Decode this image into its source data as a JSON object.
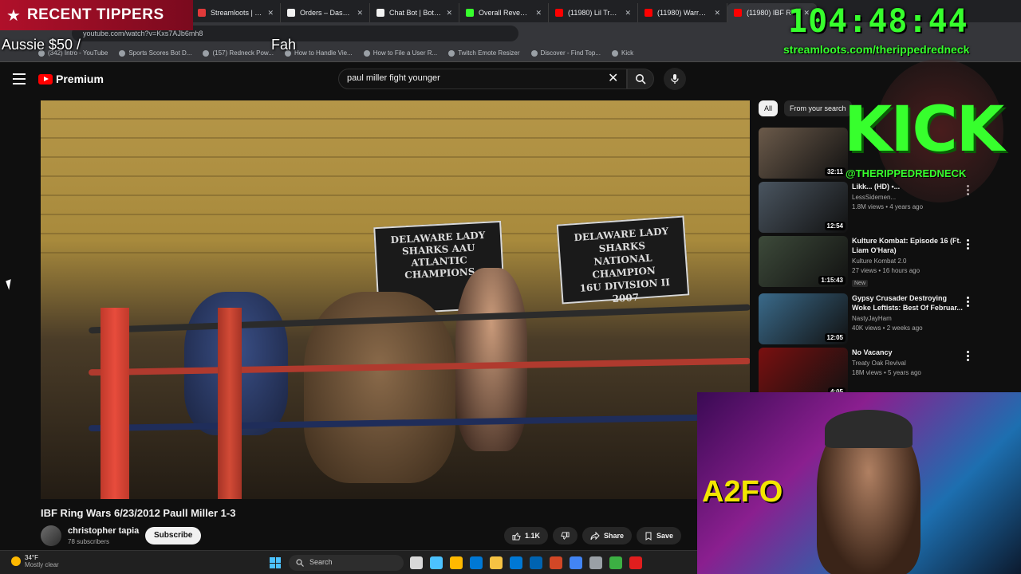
{
  "browser": {
    "tabs": [
      {
        "title": "Streamloots | The",
        "color": "#e03a3a"
      },
      {
        "title": "Orders – Dashboar",
        "color": "#f1f1f1"
      },
      {
        "title": "Chat Bot | BotRix -",
        "color": "#f1f1f1"
      },
      {
        "title": "Overall Revenue -",
        "color": "#37ff2d"
      },
      {
        "title": "(11980) Lil Troy - V",
        "color": "#ff0000"
      },
      {
        "title": "(11980) Warren G",
        "color": "#ff0000"
      },
      {
        "title": "(11980) IBF R",
        "color": "#ff0000",
        "active": true
      }
    ],
    "close_glyph": "✕",
    "url": "youtube.com/watch?v=Kxs7AJb6mh8",
    "bookmarks": [
      "(342) Intro - YouTube",
      "Sports Scores Bot D...",
      "(157) Redneck Pow...",
      "How to Handle Vie...",
      "How to File a User R...",
      "Twitch Emote Resizer",
      "Discover - Find Top...",
      "Kick"
    ]
  },
  "overlay": {
    "recent_tippers_label": "RECENT TIPPERS",
    "star_icon": "★",
    "tip_amount": "Aussie $50 /",
    "tip_name": "Fah",
    "timer": "104:48:44",
    "streamloots_url": "streamloots.com/therippedredneck",
    "kick_word": "KICK",
    "kick_handle": "@THERIPPEDREDNECK",
    "webcam_logo": "A2FO"
  },
  "youtube": {
    "logo_label": "Premium",
    "search_value": "paul miller fight younger",
    "clear_glyph": "✕",
    "video": {
      "banner1_lines": [
        "DELAWARE LADY SHARKS AAU",
        "ATLANTIC",
        "CHAMPIONS"
      ],
      "banner2_lines": [
        "DELAWARE LADY SHARKS",
        "NATIONAL CHAMPION",
        "16U DIVISION II",
        "2007"
      ],
      "title": "IBF Ring Wars 6/23/2012 Paull Miller 1-3",
      "channel": "christopher tapia",
      "subscribers": "78 subscribers",
      "subscribe_label": "Subscribe",
      "likes": "1.1K",
      "share_label": "Share",
      "save_label": "Save"
    },
    "chips": [
      "All",
      "From your search"
    ],
    "recommendations": [
      {
        "title": "",
        "channel": "",
        "meta": "",
        "duration": "32:11",
        "thumb": "#6b5a4a"
      },
      {
        "title": "Likk... (HD) •...",
        "channel": "LessSidemen...",
        "meta": "1.8M views • 4 years ago",
        "duration": "12:54",
        "thumb": "#4a5560"
      },
      {
        "title": "Kulture Kombat: Episode 16 (Ft. Liam O'Hara)",
        "channel": "Kulture Kombat 2.0",
        "meta": "27 views • 16 hours ago",
        "badge": "New",
        "duration": "1:15:43",
        "thumb": "#3d4a3a"
      },
      {
        "title": "Gypsy Crusader Destroying Woke Leftists: Best Of Februar...",
        "channel": "NastyJayHam",
        "meta": "40K views • 2 weeks ago",
        "duration": "12:05",
        "thumb": "#3a6a8a"
      },
      {
        "title": "No Vacancy",
        "channel": "Treaty Oak Revival",
        "meta": "18M views • 5 years ago",
        "duration": "4:05",
        "thumb": "#7a1010"
      }
    ]
  },
  "taskbar": {
    "weather_temp": "34°F",
    "weather_cond": "Mostly clear",
    "search_label": "Search",
    "icon_colors": [
      "#d8d8d8",
      "#4cc2ff",
      "#ffb900",
      "#0078d4",
      "#f6c343",
      "#0078d4",
      "#0063b1",
      "#d24726",
      "#4285f4",
      "#9aa0a6",
      "#3cb043",
      "#e01e1e"
    ]
  }
}
